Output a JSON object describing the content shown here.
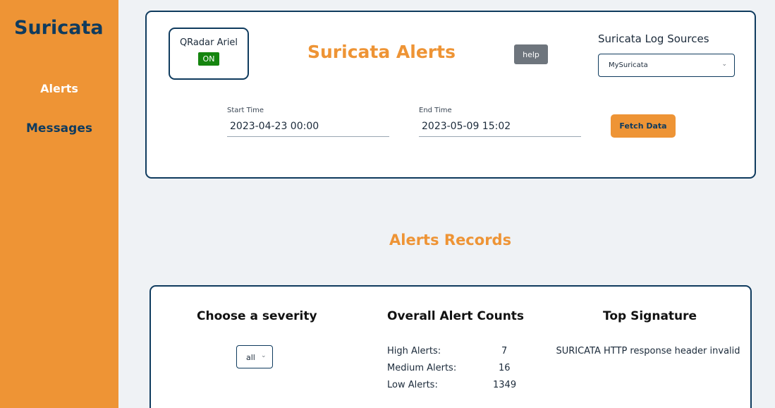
{
  "sidebar": {
    "brand": "Suricata",
    "items": [
      {
        "label": "Alerts"
      },
      {
        "label": "Messages"
      }
    ]
  },
  "header": {
    "qradar_label": "QRadar Ariel",
    "qradar_status": "ON",
    "title": "Suricata Alerts",
    "help_label": "help",
    "log_sources_label": "Suricata Log Sources",
    "log_source_selected": "MySuricata"
  },
  "time_range": {
    "start_label": "Start Time",
    "start_value": "2023-04-23 00:00",
    "end_label": "End Time",
    "end_value": "2023-05-09 15:02",
    "fetch_label": "Fetch Data"
  },
  "records": {
    "title": "Alerts Records",
    "severity_heading": "Choose a severity",
    "severity_selected": "all",
    "counts_heading": "Overall Alert Counts",
    "counts": [
      {
        "label": "High Alerts:",
        "value": "7"
      },
      {
        "label": "Medium Alerts:",
        "value": "16"
      },
      {
        "label": "Low Alerts:",
        "value": "1349"
      }
    ],
    "signature_heading": "Top Signature",
    "top_signature": "SURICATA HTTP response header invalid"
  },
  "colors": {
    "accent": "#ee9435",
    "navy": "#0f3b5e",
    "status_on": "#15850f",
    "help_gray": "#6e757d",
    "background": "#eff2f5"
  }
}
